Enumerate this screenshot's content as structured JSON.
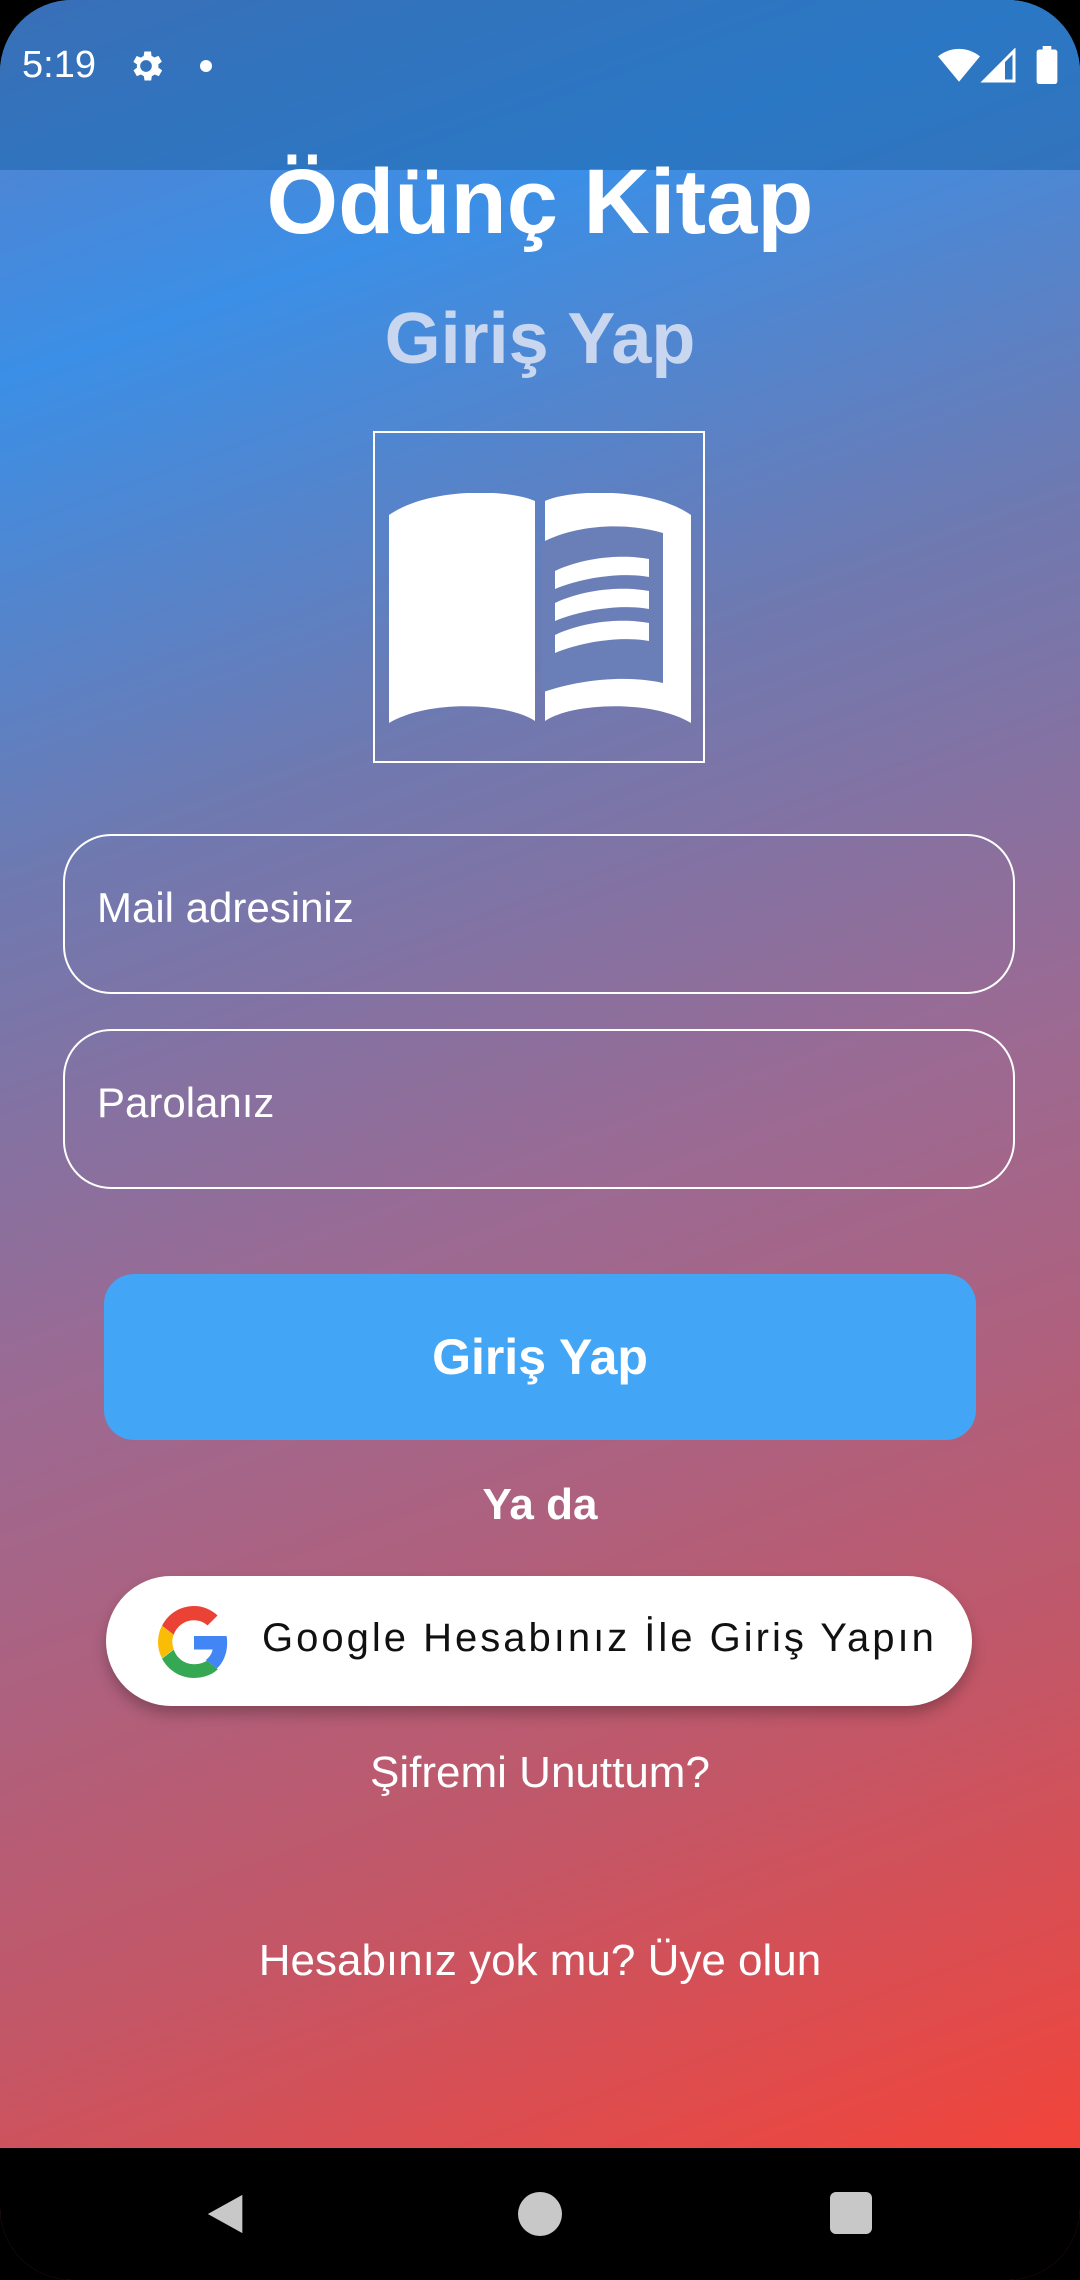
{
  "status_bar": {
    "time": "5:19",
    "icons": [
      "gear-icon",
      "dot-icon",
      "wifi-icon",
      "signal-icon",
      "battery-icon"
    ]
  },
  "header": {
    "title": "Ödünç Kitap",
    "subtitle": "Giriş Yap",
    "logo_icon": "open-book-icon"
  },
  "form": {
    "email_placeholder": "Mail adresiniz",
    "password_placeholder": "Parolanız",
    "login_label": "Giriş Yap",
    "or_label": "Ya da",
    "google_label": "Google Hesabınız İle Giriş Yapın",
    "forgot_label": "Şifremi Unuttum?",
    "signup_label": "Hesabınız yok mu? Üye olun"
  },
  "colors": {
    "login_button": "#43a5f5",
    "gradient_top": "#3b8fe6",
    "gradient_bottom": "#f2443a"
  },
  "nav_bar": {
    "icons": [
      "back-icon",
      "home-icon",
      "recents-icon"
    ]
  }
}
